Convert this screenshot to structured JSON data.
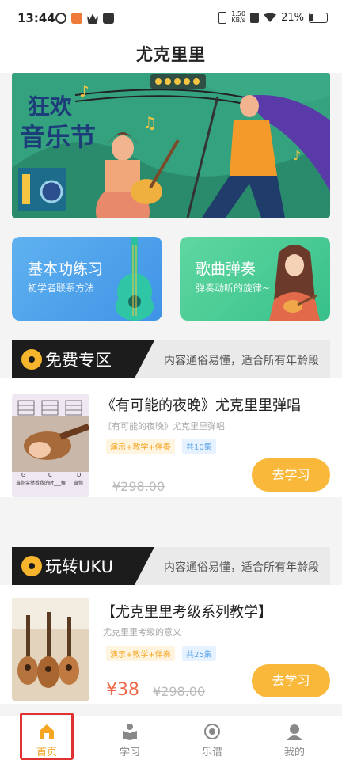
{
  "status_bar": {
    "time": "13:44",
    "net_speed": "1.50\nKB/s",
    "battery": "21%"
  },
  "app": {
    "title": "尤克里里"
  },
  "banner": {
    "text": "狂欢音乐节",
    "icon": "music-festival-illustration"
  },
  "cards": [
    {
      "title": "基本功练习",
      "subtitle": "初学者联系方法",
      "icon": "ukulele-icon"
    },
    {
      "title": "歌曲弹奏",
      "subtitle": "弹奏动听的旋律~",
      "icon": "girl-with-ukulele-illustration"
    }
  ],
  "sections": [
    {
      "title": "免费专区",
      "desc": "内容通俗易懂，适合所有年龄段",
      "course": {
        "title": "《有可能的夜晚》尤克里里弹唱",
        "subtitle": "《有可能的夜晚》尤克里里弹唱",
        "tags": [
          "演示+教学+伴奏",
          "共10集"
        ],
        "price": "",
        "old_price": "¥298.00",
        "button": "去学习",
        "thumb_chords": [
          "G",
          "C",
          "D"
        ],
        "thumb_caption": "当你突然看我的时___候",
        "thumb_caption2": "当你"
      }
    },
    {
      "title": "玩转UKU",
      "desc": "内容通俗易懂，适合所有年龄段",
      "course": {
        "title": "【尤克里里考级系列教学】",
        "subtitle": "尤克里里考级的意义",
        "tags": [
          "演示+教学+伴奏",
          "共25集"
        ],
        "price": "¥38",
        "old_price": "¥298.00",
        "button": "去学习"
      }
    }
  ],
  "tabs": [
    {
      "label": "首页",
      "icon": "home-icon",
      "active": true
    },
    {
      "label": "学习",
      "icon": "study-icon",
      "active": false
    },
    {
      "label": "乐谱",
      "icon": "score-icon",
      "active": false
    },
    {
      "label": "我的",
      "icon": "profile-icon",
      "active": false
    }
  ],
  "colors": {
    "accent": "#f6a623",
    "price": "#ef6a4a",
    "highlight": "#e03232"
  }
}
